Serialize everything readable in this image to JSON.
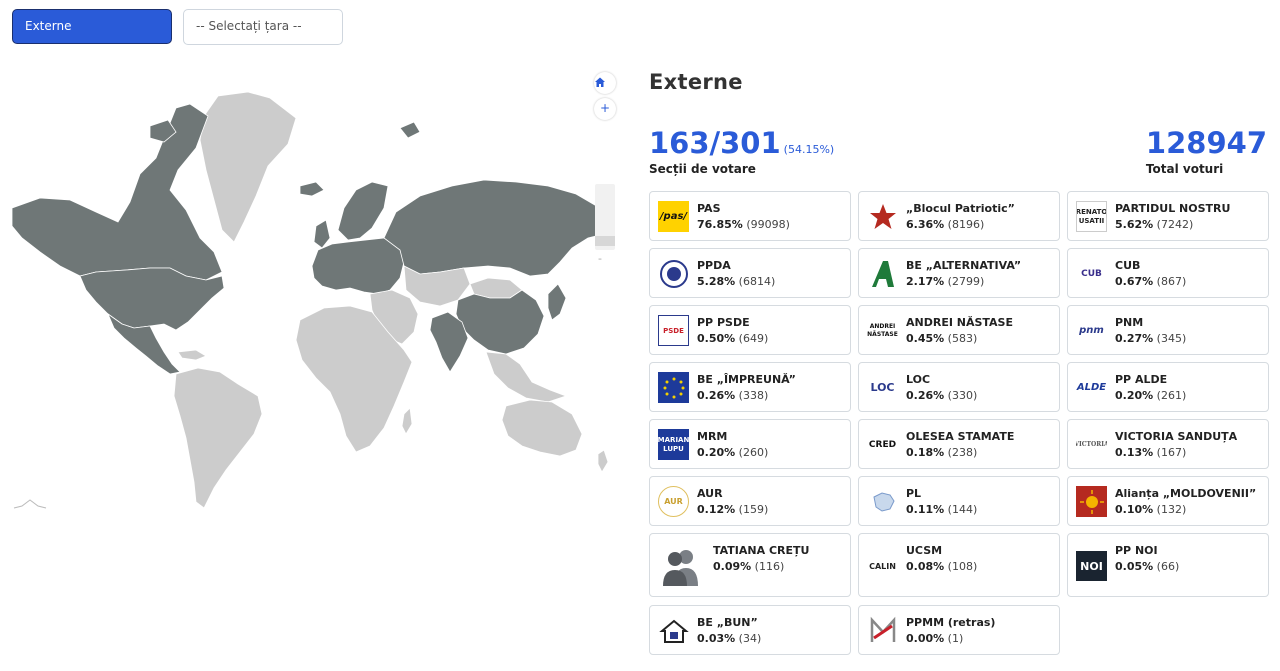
{
  "topbar": {
    "region_button": "Externe",
    "country_select_placeholder": "-- Selectați țara --"
  },
  "map": {
    "highlight_color": "#6f7777",
    "base_color": "#cccccc",
    "home_icon": "home-icon",
    "zoom_in_label": "+",
    "zoom_out_label": "-"
  },
  "results": {
    "title": "Externe",
    "sections": "163/301",
    "sections_pct": "(54.15%)",
    "sections_label": "Secții de votare",
    "total_votes": "128947",
    "total_votes_label": "Total voturi",
    "accent_color": "#2a5bd8",
    "parties": [
      {
        "name": "PAS",
        "pct": "76.85%",
        "votes": "(99098)",
        "logo": "pas-logo"
      },
      {
        "name": "„Blocul Patriotic”",
        "pct": "6.36%",
        "votes": "(8196)",
        "logo": "star-logo"
      },
      {
        "name": "PARTIDUL NOSTRU",
        "pct": "5.62%",
        "votes": "(7242)",
        "logo": "renato-usatii-logo",
        "logo_text": "RENATO USATII"
      },
      {
        "name": "PPDA",
        "pct": "5.28%",
        "votes": "(6814)",
        "logo": "ppda-logo"
      },
      {
        "name": "BE „ALTERNATIVA”",
        "pct": "2.17%",
        "votes": "(2799)",
        "logo": "alternativa-logo"
      },
      {
        "name": "CUB",
        "pct": "0.67%",
        "votes": "(867)",
        "logo": "cub-logo",
        "logo_text": "CUB"
      },
      {
        "name": "PP PSDE",
        "pct": "0.50%",
        "votes": "(649)",
        "logo": "psde-logo",
        "logo_text": "PSDE"
      },
      {
        "name": "ANDREI NĂSTASE",
        "pct": "0.45%",
        "votes": "(583)",
        "logo": "andrei-nastase-logo",
        "logo_text": "ANDREI NĂSTASE"
      },
      {
        "name": "PNM",
        "pct": "0.27%",
        "votes": "(345)",
        "logo": "pnm-logo",
        "logo_text": "pnm"
      },
      {
        "name": "BE „ÎMPREUNĂ”",
        "pct": "0.26%",
        "votes": "(338)",
        "logo": "impreuna-logo"
      },
      {
        "name": "LOC",
        "pct": "0.26%",
        "votes": "(330)",
        "logo": "loc-logo",
        "logo_text": "LOC"
      },
      {
        "name": "PP ALDE",
        "pct": "0.20%",
        "votes": "(261)",
        "logo": "alde-logo",
        "logo_text": "ALDE"
      },
      {
        "name": "MRM",
        "pct": "0.20%",
        "votes": "(260)",
        "logo": "marian-lupu-logo",
        "logo_text": "MARIAN LUPU"
      },
      {
        "name": "OLESEA STAMATE",
        "pct": "0.18%",
        "votes": "(238)",
        "logo": "cred-logo",
        "logo_text": "CRED"
      },
      {
        "name": "VICTORIA SANDUȚA",
        "pct": "0.13%",
        "votes": "(167)",
        "logo": "victoria-logo",
        "logo_text": "VICTORIA"
      },
      {
        "name": "AUR",
        "pct": "0.12%",
        "votes": "(159)",
        "logo": "aur-logo",
        "logo_text": "AUR"
      },
      {
        "name": "PL",
        "pct": "0.11%",
        "votes": "(144)",
        "logo": "pl-logo"
      },
      {
        "name": "Alianța „MOLDOVENII”",
        "pct": "0.10%",
        "votes": "(132)",
        "logo": "moldovenii-logo"
      },
      {
        "name": "TATIANA CREȚU",
        "pct": "0.09%",
        "votes": "(116)",
        "logo": "person-silhouette-logo"
      },
      {
        "name": "UCSM",
        "pct": "0.08%",
        "votes": "(108)",
        "logo": "ucsm-logo",
        "logo_text": "CALIN"
      },
      {
        "name": "PP NOI",
        "pct": "0.05%",
        "votes": "(66)",
        "logo": "noi-logo",
        "logo_text": "NOI"
      },
      {
        "name": "BE „BUN”",
        "pct": "0.03%",
        "votes": "(34)",
        "logo": "bun-logo"
      },
      {
        "name": "PPMM (retras)",
        "pct": "0.00%",
        "votes": "(1)",
        "logo": "ppmm-logo"
      }
    ]
  }
}
